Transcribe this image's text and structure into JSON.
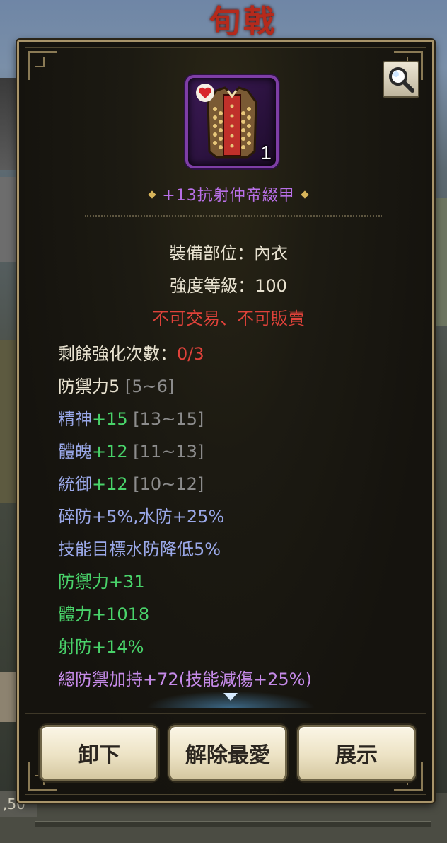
{
  "background": {
    "title_fragment": "旬戟",
    "bottom_left_text": ",50"
  },
  "item": {
    "name": "+13抗射仲帝綴甲",
    "count": "1",
    "rarity_color": "#b970e8"
  },
  "info": {
    "slot": "裝備部位：內衣",
    "level": "強度等級：100",
    "trade_notice": "不可交易、不可販賣"
  },
  "stats": [
    {
      "label": "剩餘強化次數：",
      "value": "0/3",
      "range": ""
    },
    {
      "label": "防禦力5",
      "value": "",
      "range": "[5~6]"
    },
    {
      "label": "精神",
      "value": "+15",
      "range": "[13~15]"
    },
    {
      "label": "體魄",
      "value": "+12",
      "range": "[11~13]"
    },
    {
      "label": "統御",
      "value": "+12",
      "range": "[10~12]"
    },
    {
      "label": "碎防+5%,水防+25%",
      "value": "",
      "range": ""
    },
    {
      "label": "技能目標水防降低5%",
      "value": "",
      "range": ""
    },
    {
      "label": "防禦力+31",
      "value": "",
      "range": ""
    },
    {
      "label": "體力+1018",
      "value": "",
      "range": ""
    },
    {
      "label": "射防+14%",
      "value": "",
      "range": ""
    },
    {
      "label": "總防禦加持+72(技能減傷+25%)",
      "value": "",
      "range": ""
    }
  ],
  "buttons": {
    "unequip": "卸下",
    "unfavorite": "解除最愛",
    "show": "展示"
  },
  "icons": {
    "zoom": "magnifier-icon",
    "favorite": "heart-icon",
    "scroll": "chevron-down-icon",
    "item": "armor-vest-icon"
  },
  "colors": {
    "panel_border": "#a8946a",
    "red_text": "#e0423a",
    "blue_text": "#9aa8e8",
    "green_text": "#49d36a",
    "gray_text": "#8c8c8c"
  }
}
